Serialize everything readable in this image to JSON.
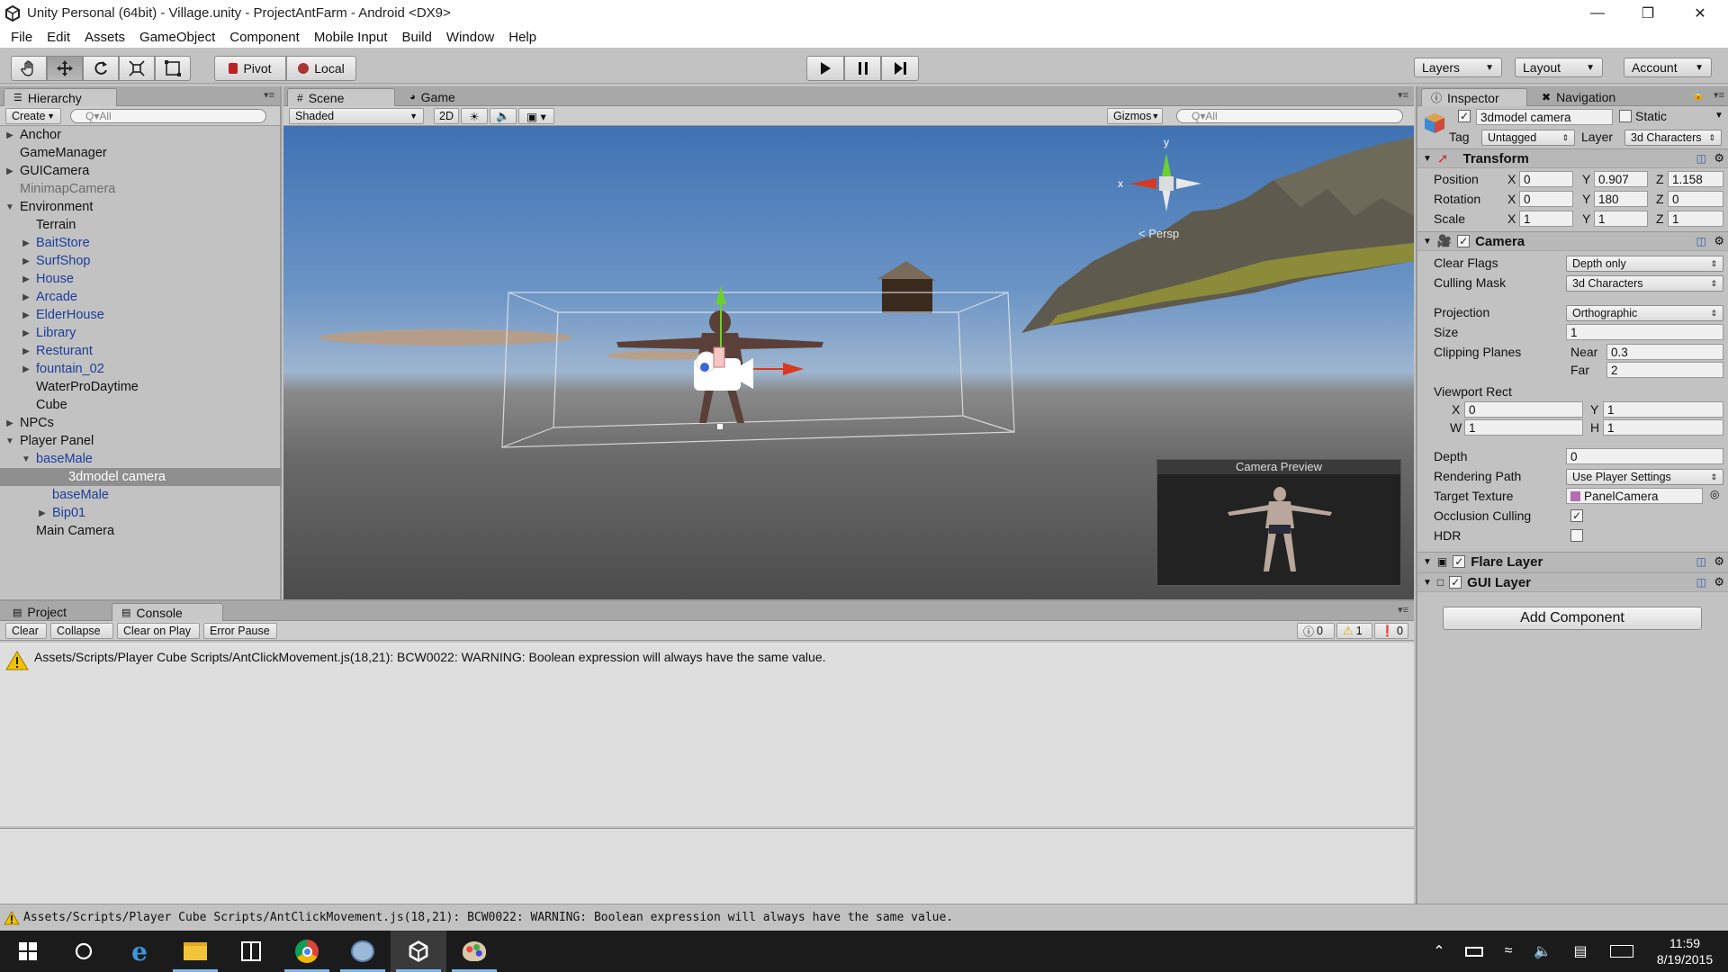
{
  "window": {
    "title": "Unity Personal (64bit) - Village.unity - ProjectAntFarm - Android <DX9>",
    "controls": [
      "minimize",
      "maximize",
      "close"
    ]
  },
  "menu": [
    "File",
    "Edit",
    "Assets",
    "GameObject",
    "Component",
    "Mobile Input",
    "Build",
    "Window",
    "Help"
  ],
  "toolbar": {
    "pivot_label": "Pivot",
    "local_label": "Local",
    "layers_label": "Layers",
    "layout_label": "Layout",
    "account_label": "Account"
  },
  "hierarchy": {
    "tab_label": "Hierarchy",
    "create_label": "Create",
    "search_placeholder": "Q▾All",
    "items": [
      {
        "label": "Anchor",
        "indent": 0,
        "arrow": "right",
        "style": ""
      },
      {
        "label": "GameManager",
        "indent": 0,
        "arrow": "",
        "style": ""
      },
      {
        "label": "GUICamera",
        "indent": 0,
        "arrow": "right",
        "style": ""
      },
      {
        "label": "MinimapCamera",
        "indent": 0,
        "arrow": "",
        "style": "grey"
      },
      {
        "label": "Environment",
        "indent": 0,
        "arrow": "down",
        "style": ""
      },
      {
        "label": "Terrain",
        "indent": 1,
        "arrow": "",
        "style": ""
      },
      {
        "label": "BaitStore",
        "indent": 1,
        "arrow": "right",
        "style": "blue"
      },
      {
        "label": "SurfShop",
        "indent": 1,
        "arrow": "right",
        "style": "blue"
      },
      {
        "label": "House",
        "indent": 1,
        "arrow": "right",
        "style": "blue"
      },
      {
        "label": "Arcade",
        "indent": 1,
        "arrow": "right",
        "style": "blue"
      },
      {
        "label": "ElderHouse",
        "indent": 1,
        "arrow": "right",
        "style": "blue"
      },
      {
        "label": "Library",
        "indent": 1,
        "arrow": "right",
        "style": "blue"
      },
      {
        "label": "Resturant",
        "indent": 1,
        "arrow": "right",
        "style": "blue"
      },
      {
        "label": "fountain_02",
        "indent": 1,
        "arrow": "right",
        "style": "blue"
      },
      {
        "label": "WaterProDaytime",
        "indent": 1,
        "arrow": "",
        "style": ""
      },
      {
        "label": "Cube",
        "indent": 1,
        "arrow": "",
        "style": ""
      },
      {
        "label": "NPCs",
        "indent": 0,
        "arrow": "right",
        "style": ""
      },
      {
        "label": "Player Panel",
        "indent": 0,
        "arrow": "down",
        "style": ""
      },
      {
        "label": "baseMale",
        "indent": 1,
        "arrow": "down",
        "style": "blue"
      },
      {
        "label": "3dmodel camera",
        "indent": 2,
        "arrow": "",
        "style": "sel"
      },
      {
        "label": "baseMale",
        "indent": 2,
        "arrow": "",
        "style": "blue"
      },
      {
        "label": "Bip01",
        "indent": 2,
        "arrow": "right",
        "style": "blue"
      },
      {
        "label": "Main Camera",
        "indent": 1,
        "arrow": "",
        "style": ""
      }
    ]
  },
  "scene": {
    "tab_scene": "Scene",
    "tab_game": "Game",
    "shading": "Shaded",
    "mode_2d": "2D",
    "gizmos_label": "Gizmos",
    "search_placeholder": "Q▾All",
    "persp_label": "< Persp",
    "camera_preview_label": "Camera Preview",
    "axis_labels": {
      "y": "y",
      "x": "x"
    }
  },
  "console": {
    "tab_project": "Project",
    "tab_console": "Console",
    "buttons": [
      "Clear",
      "Collapse",
      "Clear on Play",
      "Error Pause"
    ],
    "counts": {
      "info": "0",
      "warning": "1",
      "error": "0"
    },
    "message": "Assets/Scripts/Player Cube Scripts/AntClickMovement.js(18,21): BCW0022: WARNING: Boolean expression will always have the same value.",
    "status_message": "Assets/Scripts/Player Cube Scripts/AntClickMovement.js(18,21): BCW0022: WARNING: Boolean expression will always have the same value."
  },
  "inspector": {
    "tab_inspector": "Inspector",
    "tab_navigation": "Navigation",
    "object_name": "3dmodel camera",
    "static_label": "Static",
    "tag_label": "Tag",
    "tag_value": "Untagged",
    "layer_label": "Layer",
    "layer_value": "3d Characters",
    "transform": {
      "title": "Transform",
      "position_label": "Position",
      "rotation_label": "Rotation",
      "scale_label": "Scale",
      "position": {
        "x": "0",
        "y": "0.907",
        "z": "1.158"
      },
      "rotation": {
        "x": "0",
        "y": "180",
        "z": "0"
      },
      "scale": {
        "x": "1",
        "y": "1",
        "z": "1"
      },
      "axis_x": "X",
      "axis_y": "Y",
      "axis_z": "Z"
    },
    "camera": {
      "title": "Camera",
      "clear_flags_label": "Clear Flags",
      "clear_flags_value": "Depth only",
      "culling_mask_label": "Culling Mask",
      "culling_mask_value": "3d Characters",
      "projection_label": "Projection",
      "projection_value": "Orthographic",
      "size_label": "Size",
      "size_value": "1",
      "clipping_label": "Clipping Planes",
      "near_label": "Near",
      "near_value": "0.3",
      "far_label": "Far",
      "far_value": "2",
      "viewport_label": "Viewport Rect",
      "vp_x_label": "X",
      "vp_x": "0",
      "vp_y_label": "Y",
      "vp_y": "1",
      "vp_w_label": "W",
      "vp_w": "1",
      "vp_h_label": "H",
      "vp_h": "1",
      "depth_label": "Depth",
      "depth_value": "0",
      "rendering_path_label": "Rendering Path",
      "rendering_path_value": "Use Player Settings",
      "target_texture_label": "Target Texture",
      "target_texture_value": "PanelCamera",
      "occlusion_label": "Occlusion Culling",
      "occlusion_checked": true,
      "hdr_label": "HDR",
      "hdr_checked": false
    },
    "flare_layer_title": "Flare Layer",
    "gui_layer_title": "GUI Layer",
    "add_component_label": "Add Component"
  },
  "taskbar": {
    "time": "11:59",
    "date": "8/19/2015"
  }
}
